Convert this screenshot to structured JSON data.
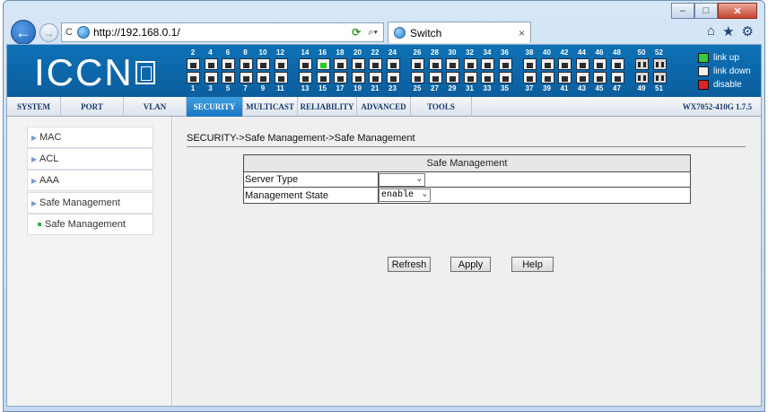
{
  "browser": {
    "url": "http://192.168.0.1/",
    "tab_title": "Switch",
    "tab_close": "×",
    "back_glyph": "←",
    "forward_glyph": "→",
    "minimize": "–",
    "maximize": "□",
    "close": "✕",
    "toolbar_icons": [
      "home-icon",
      "favorites-star-icon",
      "settings-gear-icon"
    ]
  },
  "banner": {
    "logo_text": "ICCN",
    "ports_top_numbers": [
      "2",
      "4",
      "6",
      "8",
      "10",
      "12",
      "14",
      "16",
      "18",
      "20",
      "22",
      "24",
      "26",
      "28",
      "30",
      "32",
      "34",
      "36",
      "38",
      "40",
      "42",
      "44",
      "46",
      "48",
      "50",
      "52"
    ],
    "ports_bottom_numbers": [
      "1",
      "3",
      "5",
      "7",
      "9",
      "11",
      "13",
      "15",
      "17",
      "19",
      "21",
      "23",
      "25",
      "27",
      "29",
      "31",
      "33",
      "35",
      "37",
      "39",
      "41",
      "43",
      "45",
      "47",
      "49",
      "51"
    ],
    "ports_link_up": [
      "16"
    ],
    "legend": {
      "link_up": "link up",
      "link_down": "link down",
      "disable": "disable"
    },
    "colors": {
      "banner": "#0c66a8",
      "link_up": "#2ecc40",
      "disable": "#e02222"
    }
  },
  "menu": {
    "items": [
      "SYSTEM",
      "PORT",
      "VLAN",
      "SECURITY",
      "MULTICAST",
      "RELIABILITY",
      "ADVANCED",
      "TOOLS"
    ],
    "active": "SECURITY",
    "version": "WX7052-410G 1.7.5"
  },
  "sidebar": {
    "items": [
      "MAC",
      "ACL",
      "AAA",
      "Safe Management"
    ],
    "sub_items": [
      "Safe Management"
    ]
  },
  "main": {
    "breadcrumb": "SECURITY->Safe Management->Safe Management",
    "table_title": "Safe Management",
    "rows": [
      {
        "label": "Server Type",
        "value": ""
      },
      {
        "label": "Management State",
        "value": "enable"
      }
    ],
    "buttons": {
      "refresh": "Refresh",
      "apply": "Apply",
      "help": "Help"
    }
  }
}
